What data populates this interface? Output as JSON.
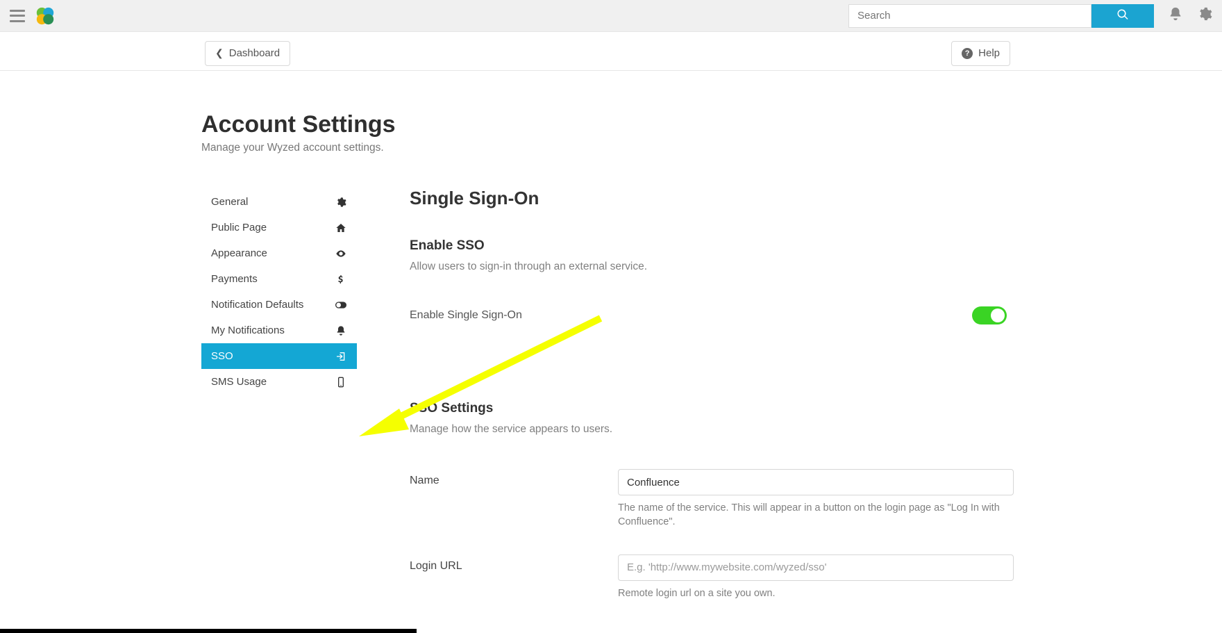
{
  "topbar": {
    "search_placeholder": "Search"
  },
  "subbar": {
    "dashboard_label": "Dashboard",
    "help_label": "Help"
  },
  "page": {
    "title": "Account Settings",
    "subtitle": "Manage your Wyzed account settings."
  },
  "sidenav": {
    "items": [
      {
        "label": "General",
        "icon": "gear"
      },
      {
        "label": "Public Page",
        "icon": "home"
      },
      {
        "label": "Appearance",
        "icon": "eye"
      },
      {
        "label": "Payments",
        "icon": "dollar"
      },
      {
        "label": "Notification Defaults",
        "icon": "toggle"
      },
      {
        "label": "My Notifications",
        "icon": "bell"
      },
      {
        "label": "SSO",
        "icon": "login",
        "active": true
      },
      {
        "label": "SMS Usage",
        "icon": "phone"
      }
    ]
  },
  "panel": {
    "section_title": "Single Sign-On",
    "enable_title": "Enable SSO",
    "enable_desc": "Allow users to sign-in through an external service.",
    "enable_label": "Enable Single Sign-On",
    "enable_value": true,
    "settings_title": "SSO Settings",
    "settings_desc": "Manage how the service appears to users.",
    "name_label": "Name",
    "name_value": "Confluence",
    "name_help": "The name of the service. This will appear in a button on the login page as \"Log In with Confluence\".",
    "login_label": "Login URL",
    "login_placeholder": "E.g. 'http://www.mywebsite.com/wyzed/sso'",
    "login_value": "",
    "login_help": "Remote login url on a site you own."
  },
  "colors": {
    "accent": "#14a7d4",
    "toggle_on": "#3ad424",
    "arrow": "#faff00"
  }
}
